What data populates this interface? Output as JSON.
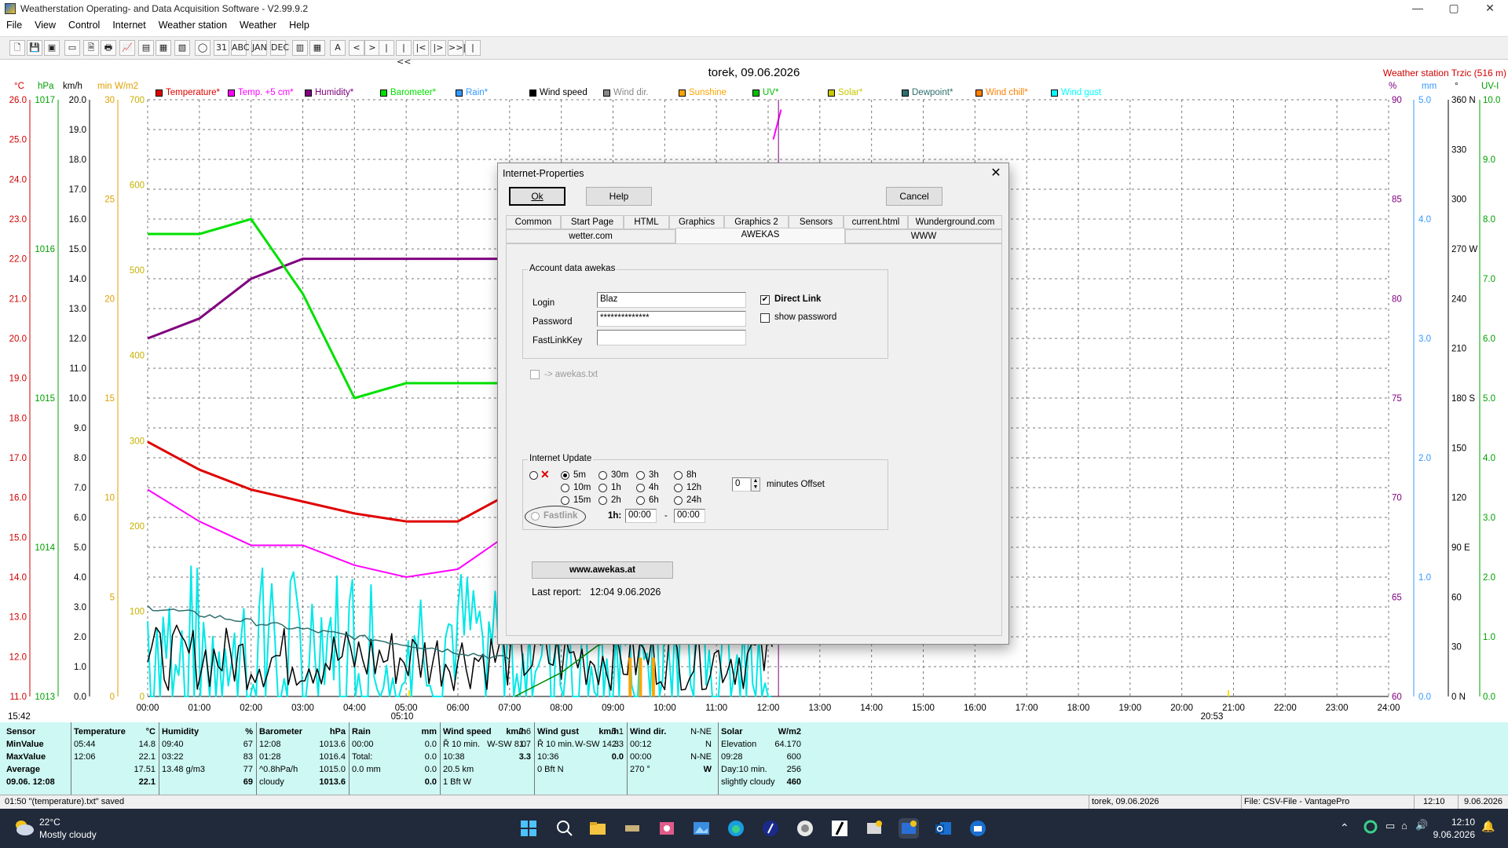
{
  "window": {
    "title": "Weatherstation Operating- and Data Acquisition Software - V2.99.9.2",
    "min": "—",
    "max": "▢",
    "close": "✕"
  },
  "menu": [
    "File",
    "View",
    "Control",
    "Internet",
    "Weather station",
    "Weather",
    "Help"
  ],
  "toolbar": {
    "buttons": [
      "🗋",
      "💾",
      "▣",
      "▭",
      "🗎",
      "🖶",
      "📈",
      "▤",
      "▦",
      "▧",
      "◯",
      "31",
      "ABC",
      "JAN",
      "DEC",
      "▥",
      "▦",
      "A",
      "<",
      ">",
      "|",
      "|<<",
      "|<",
      "|>",
      ">>|",
      "|"
    ]
  },
  "chart": {
    "date": "torek, 09.06.2026",
    "station": "Weather station Trzic (516 m)",
    "units_left": [
      "°C",
      "hPa",
      "km/h",
      "min",
      "W/m2"
    ],
    "units_right": [
      "%",
      "mm",
      "°",
      "UV-I"
    ],
    "legend": [
      {
        "label": "Temperature*",
        "color": "#e00000"
      },
      {
        "label": "Temp. +5 cm*",
        "color": "#ff00ff"
      },
      {
        "label": "Humidity*",
        "color": "#800080"
      },
      {
        "label": "Barometer*",
        "color": "#00e000"
      },
      {
        "label": "Rain*",
        "color": "#3399ff"
      },
      {
        "label": "Wind speed",
        "color": "#000000"
      },
      {
        "label": "Wind dir.",
        "color": "#888888"
      },
      {
        "label": "Sunshine",
        "color": "#ffa500"
      },
      {
        "label": "UV*",
        "color": "#00c000"
      },
      {
        "label": "Solar*",
        "color": "#c8c800"
      },
      {
        "label": "Dewpoint*",
        "color": "#2e6e6e"
      },
      {
        "label": "Wind chill*",
        "color": "#ff8000"
      },
      {
        "label": "Wind gust",
        "color": "#00ffff"
      }
    ],
    "temp_ticks": [
      "26.0",
      "25.0",
      "24.0",
      "23.0",
      "22.0",
      "21.0",
      "20.0",
      "19.0",
      "18.0",
      "17.0",
      "16.0",
      "15.0",
      "14.0",
      "13.0",
      "12.0",
      "11.0"
    ],
    "hpa_ticks": [
      "1017",
      "1016",
      "1015",
      "1014",
      "1013"
    ],
    "kmh_ticks": [
      "20.0",
      "19.0",
      "18.0",
      "17.0",
      "16.0",
      "15.0",
      "14.0",
      "13.0",
      "12.0",
      "11.0",
      "10.0",
      "9.0",
      "8.0",
      "7.0",
      "6.0",
      "5.0",
      "4.0",
      "3.0",
      "2.0",
      "1.0",
      "0.0"
    ],
    "min_ticks": [
      "30",
      "25",
      "20",
      "15",
      "10",
      "5",
      "0"
    ],
    "wm2_ticks": [
      "700",
      "600",
      "500",
      "400",
      "300",
      "200",
      "100",
      "0"
    ],
    "hum_ticks": [
      "90",
      "85",
      "80",
      "75",
      "70",
      "65",
      "60"
    ],
    "mm_ticks": [
      "5.0",
      "4.0",
      "3.0",
      "2.0",
      "1.0",
      "0.0"
    ],
    "deg_ticks": [
      "360 N",
      "330",
      "300",
      "270 W",
      "240",
      "210",
      "180 S",
      "150",
      "120",
      "90 E",
      "60",
      "30",
      "0 N"
    ],
    "uv_ticks": [
      "10.0",
      "9.0",
      "8.0",
      "7.0",
      "6.0",
      "5.0",
      "4.0",
      "3.0",
      "2.0",
      "1.0",
      "0.0"
    ],
    "x_ticks": [
      "00:00",
      "01:00",
      "02:00",
      "03:00",
      "04:00",
      "05:00",
      "06:00",
      "07:00",
      "08:00",
      "09:00",
      "10:00",
      "11:00",
      "12:00",
      "13:00",
      "14:00",
      "15:00",
      "16:00",
      "17:00",
      "18:00",
      "19:00",
      "20:00",
      "21:00",
      "22:00",
      "23:00",
      "24:00"
    ],
    "sunrise": "05:10",
    "sunset": "20:53",
    "left_time": "15:42"
  },
  "chart_data": {
    "type": "line",
    "x": [
      "00:00",
      "01:00",
      "02:00",
      "03:00",
      "04:00",
      "05:00",
      "06:00",
      "07:00"
    ],
    "series": [
      {
        "name": "Temperature*",
        "values": [
          17.4,
          16.7,
          16.2,
          15.9,
          15.6,
          15.4,
          15.4,
          16.1
        ]
      },
      {
        "name": "Temp. +5 cm*",
        "values": [
          16.2,
          15.4,
          14.8,
          14.8,
          14.3,
          14.0,
          14.2,
          15.1
        ]
      },
      {
        "name": "Humidity*",
        "values": [
          78.0,
          79.0,
          81.0,
          82.0,
          82.0,
          82.0,
          82.0,
          82.0
        ]
      },
      {
        "name": "Barometer*",
        "values": [
          1016.1,
          1016.1,
          1016.2,
          1015.7,
          1015.0,
          1015.1,
          1015.1,
          1015.1
        ]
      }
    ],
    "ylim": [
      11.0,
      26.0
    ]
  },
  "stats": {
    "sensor": [
      "Sensor",
      "MinValue",
      "MaxValue",
      "Average",
      "09.06. 12:08"
    ],
    "temperature": {
      "head": "Temperature",
      "unit": "°C",
      "rows": [
        [
          "05:44",
          "14.8"
        ],
        [
          "12:06",
          "22.1"
        ],
        [
          "",
          "17.51"
        ],
        [
          "",
          "22.1"
        ]
      ]
    },
    "humidity": {
      "head": "Humidity",
      "unit": "%",
      "rows": [
        [
          "09:40",
          "67"
        ],
        [
          "03:22",
          "83"
        ],
        [
          "",
          "77"
        ],
        [
          "13.48 g/m3",
          "69"
        ]
      ]
    },
    "barometer": {
      "head": "Barometer",
      "unit": "hPa",
      "rows": [
        [
          "12:08",
          "1013.6"
        ],
        [
          "01:28",
          "1016.4"
        ],
        [
          "^0.8hPa/h",
          "1015.0"
        ],
        [
          "cloudy",
          "1013.6"
        ]
      ]
    },
    "rain": {
      "head": "Rain",
      "unit": "mm",
      "rows": [
        [
          "",
          "0.0"
        ],
        [
          "00:00",
          "0.0"
        ],
        [
          "Total:",
          "0.0"
        ],
        [
          "0.0 mm",
          "0.0"
        ]
      ]
    },
    "windspeed": {
      "head": "Wind speed",
      "unit": "km/h",
      "rows": [
        [
          "Ř 10 min.",
          "",
          "2.6"
        ],
        [
          "10:38",
          "W-SW 8.0",
          ""
        ],
        [
          "20.5 km",
          "",
          "1.7"
        ],
        [
          "1 Bft W",
          "",
          "3.3"
        ]
      ]
    },
    "windgust": {
      "head": "Wind gust",
      "unit": "km/h",
      "rows": [
        [
          "Ř 10 min.",
          "",
          "5.1"
        ],
        [
          "10:36",
          "W-SW 14.3",
          ""
        ],
        [
          "",
          "",
          "2.3"
        ],
        [
          "0 Bft N",
          "",
          "0.0"
        ]
      ]
    },
    "winddir": {
      "head": "Wind dir.",
      "rows": [
        [
          "00:12",
          "N-NE"
        ],
        [
          "00:00",
          "N"
        ],
        [
          "",
          "N-NE"
        ],
        [
          "270 °",
          "W"
        ]
      ]
    },
    "solar": {
      "head": "Solar",
      "unit": "W/m2",
      "rows": [
        [
          "Elevation",
          "64.170"
        ],
        [
          "09:28",
          "600"
        ],
        [
          "Day:10 min.",
          "256"
        ],
        [
          "slightly cloudy",
          "460"
        ]
      ]
    }
  },
  "statusbar": {
    "left": "01:50  \"(temperature).txt\"  saved",
    "date": "torek, 09.06.2026",
    "file": "File: CSV-File - VantagePro",
    "time": "12:10",
    "day": "9.06.2026"
  },
  "dialog": {
    "title": "Internet-Properties",
    "ok": "Ok",
    "help": "Help",
    "cancel": "Cancel",
    "tabs_row1": [
      "Common",
      "Start Page",
      "HTML",
      "Graphics",
      "Graphics 2",
      "Sensors",
      "current.html",
      "Wunderground.com"
    ],
    "tabs_row2": [
      "wetter.com",
      "AWEKAS",
      "WWW"
    ],
    "account_group": "Account data awekas",
    "login_label": "Login",
    "login_value": "Blaz",
    "password_label": "Password",
    "password_value": "**************",
    "fastlink_label": "FastLinkKey",
    "fastlink_value": "",
    "direct_link": "Direct Link",
    "show_password": "show password",
    "awekas_txt": "-> awekas.txt",
    "update_group": "Internet Update",
    "intervals": [
      "5m",
      "10m",
      "15m",
      "30m",
      "1h",
      "2h",
      "3h",
      "4h",
      "6h",
      "8h",
      "12h",
      "24h"
    ],
    "offset_value": "0",
    "offset_label": "minutes Offset",
    "fastlink": "Fastlink",
    "onehour": "1h:",
    "from": "00:00",
    "dash": "-",
    "to": "00:00",
    "site_button": "www.awekas.at",
    "last_report_label": "Last report:",
    "last_report_value": "12:04  9.06.2026"
  },
  "taskbar": {
    "weather_temp": "22°C",
    "weather_desc": "Mostly cloudy",
    "clock_time": "12:10",
    "clock_date": "9.06.2026"
  }
}
